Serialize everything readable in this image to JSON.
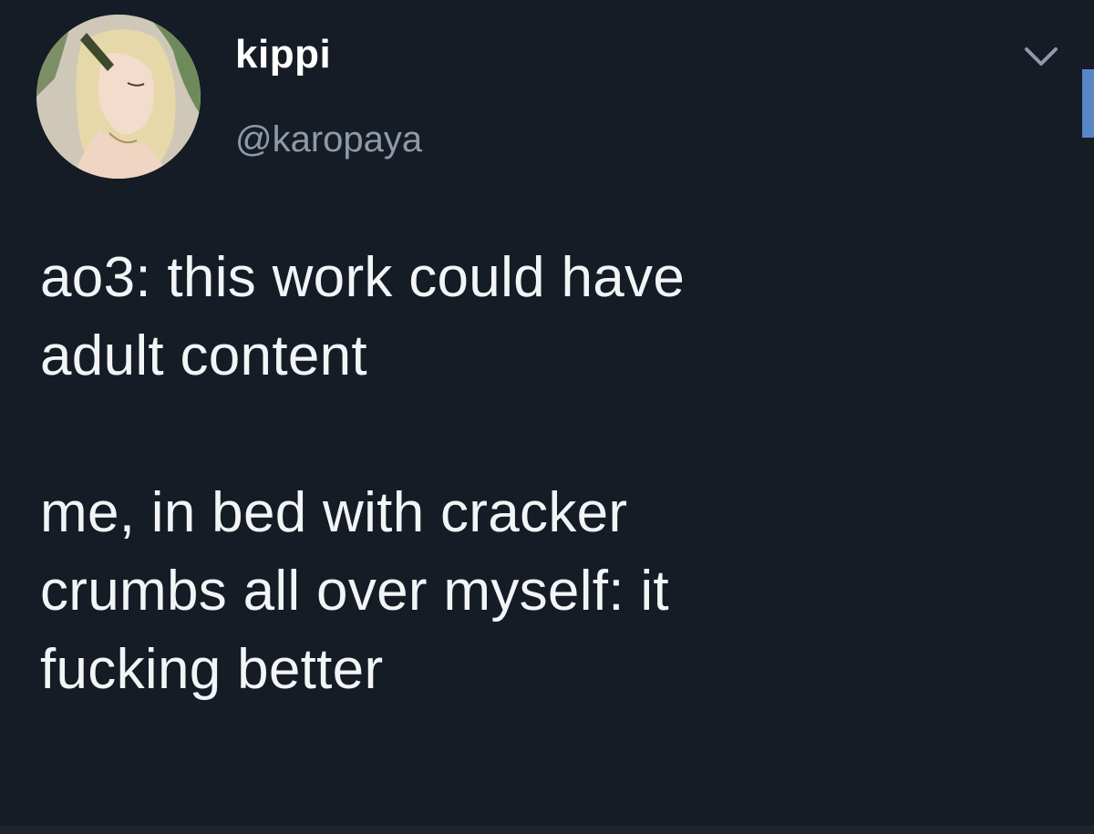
{
  "tweet": {
    "author": {
      "display_name": "kippi",
      "handle": "@karopaya",
      "avatar_icon": "profile-avatar"
    },
    "text": "ao3: this work could have\nadult content\n\nme, in bed with cracker\ncrumbs all over myself: it\nfucking better",
    "menu_icon": "chevron-down-icon"
  },
  "colors": {
    "background": "#151c26",
    "text": "#f2f4f6",
    "handle": "#8f9aa6",
    "accent": "#5a86c6"
  }
}
